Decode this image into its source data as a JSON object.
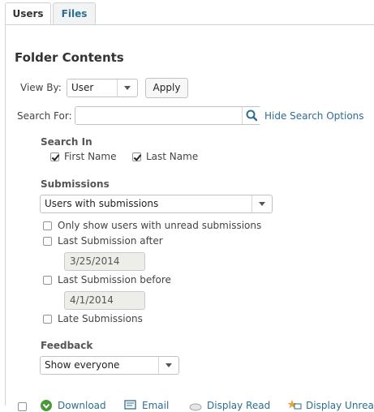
{
  "tabs": [
    {
      "label": "Users",
      "active": true
    },
    {
      "label": "Files",
      "active": false
    }
  ],
  "page_title": "Folder Contents",
  "view_by": {
    "label": "View By:",
    "selected": "User",
    "apply_label": "Apply"
  },
  "search": {
    "label": "Search For:",
    "value": "",
    "hide_options_label": "Hide Search Options"
  },
  "search_in": {
    "heading": "Search In",
    "first_name": {
      "label": "First Name",
      "checked": true
    },
    "last_name": {
      "label": "Last Name",
      "checked": true
    }
  },
  "submissions": {
    "heading": "Submissions",
    "selected": "Users with submissions",
    "unread_only": {
      "label": "Only show users with unread submissions",
      "checked": false
    },
    "after": {
      "label": "Last Submission after",
      "checked": false,
      "date": "3/25/2014"
    },
    "before": {
      "label": "Last Submission before",
      "checked": false,
      "date": "4/1/2014"
    },
    "late": {
      "label": "Late Submissions",
      "checked": false
    }
  },
  "feedback": {
    "heading": "Feedback",
    "selected": "Show everyone"
  },
  "toolbar": {
    "download_label": "Download",
    "email_label": "Email",
    "display_read_label": "Display Read",
    "display_unread_label": "Display Unread"
  },
  "colors": {
    "link": "#2e6e8e",
    "accent_green": "#4a9a3a",
    "border": "#cfd3d6"
  }
}
